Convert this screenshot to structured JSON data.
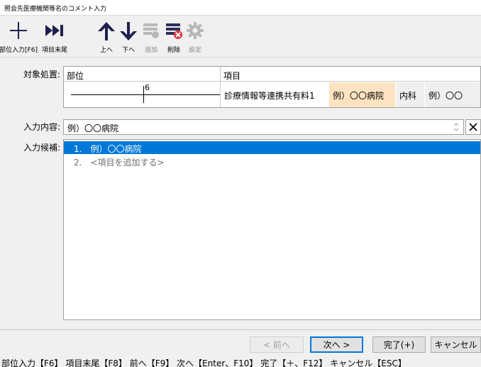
{
  "window": {
    "title": "照会先医療機関等名のコメント入力"
  },
  "toolbar": {
    "items": [
      {
        "label": "部位入力[F6]",
        "icon": "plus-icon",
        "enabled": true
      },
      {
        "label": "項目末尾",
        "icon": "skip-to-end-icon",
        "enabled": true
      },
      {
        "label": "上へ",
        "icon": "arrow-up-icon",
        "enabled": true
      },
      {
        "label": "下へ",
        "icon": "arrow-down-icon",
        "enabled": true
      },
      {
        "label": "追加",
        "icon": "add-row-icon",
        "enabled": false
      },
      {
        "label": "削除",
        "icon": "delete-row-icon",
        "enabled": true
      },
      {
        "label": "設定",
        "icon": "gear-icon",
        "enabled": false
      }
    ]
  },
  "target": {
    "label": "対象処置:",
    "columns": [
      "部位",
      "項目"
    ],
    "site_number": "6",
    "item_name": "診療情報等連携共有料1",
    "item_value": "例）〇〇病院",
    "item_dept": "内科",
    "item_extra": "例）〇〇"
  },
  "input": {
    "label": "入力内容:",
    "value": "例）〇〇病院"
  },
  "candidates": {
    "label": "入力候補:",
    "items": [
      {
        "text": "1.　例）〇〇病院",
        "selected": true
      },
      {
        "text": "2.　<項目を追加する>",
        "selected": false
      }
    ]
  },
  "buttons": {
    "prev": "< 前へ",
    "next": "次へ >",
    "done": "完了(+)",
    "cancel": "キャンセル"
  },
  "status_bar": "部位入力【F6】 項目末尾【F8】 前へ【F9】 次へ【Enter、F10】 完了【＋、F12】 キャンセル【ESC】",
  "colors": {
    "selection": "#0078d7",
    "highlight_cell": "#fde3bf"
  }
}
